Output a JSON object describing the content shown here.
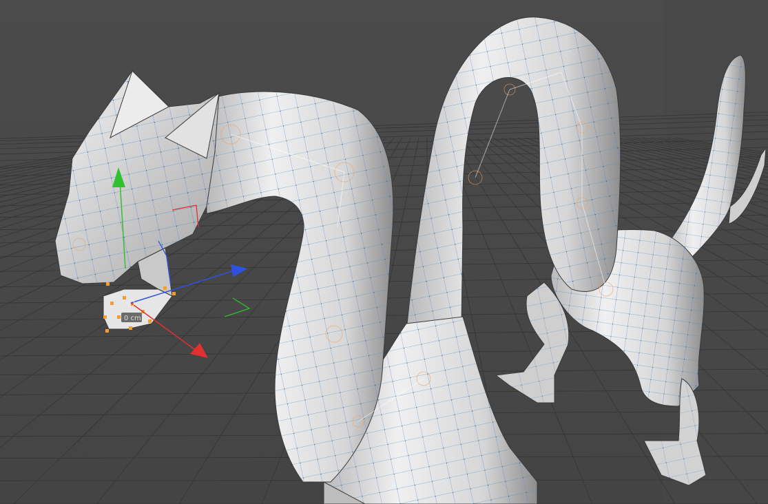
{
  "viewport": {
    "background": "#4a4a4a",
    "grid_color": "#2e2e2e",
    "mesh_fill": "#d8d8d8",
    "wire_color": "#3a7fc4",
    "selection_color": "#f0a030"
  },
  "transform_gizmo": {
    "x_axis_color": "#e03030",
    "y_axis_color": "#30c030",
    "z_axis_color": "#3050e0",
    "distance_readout": "0 cm"
  }
}
